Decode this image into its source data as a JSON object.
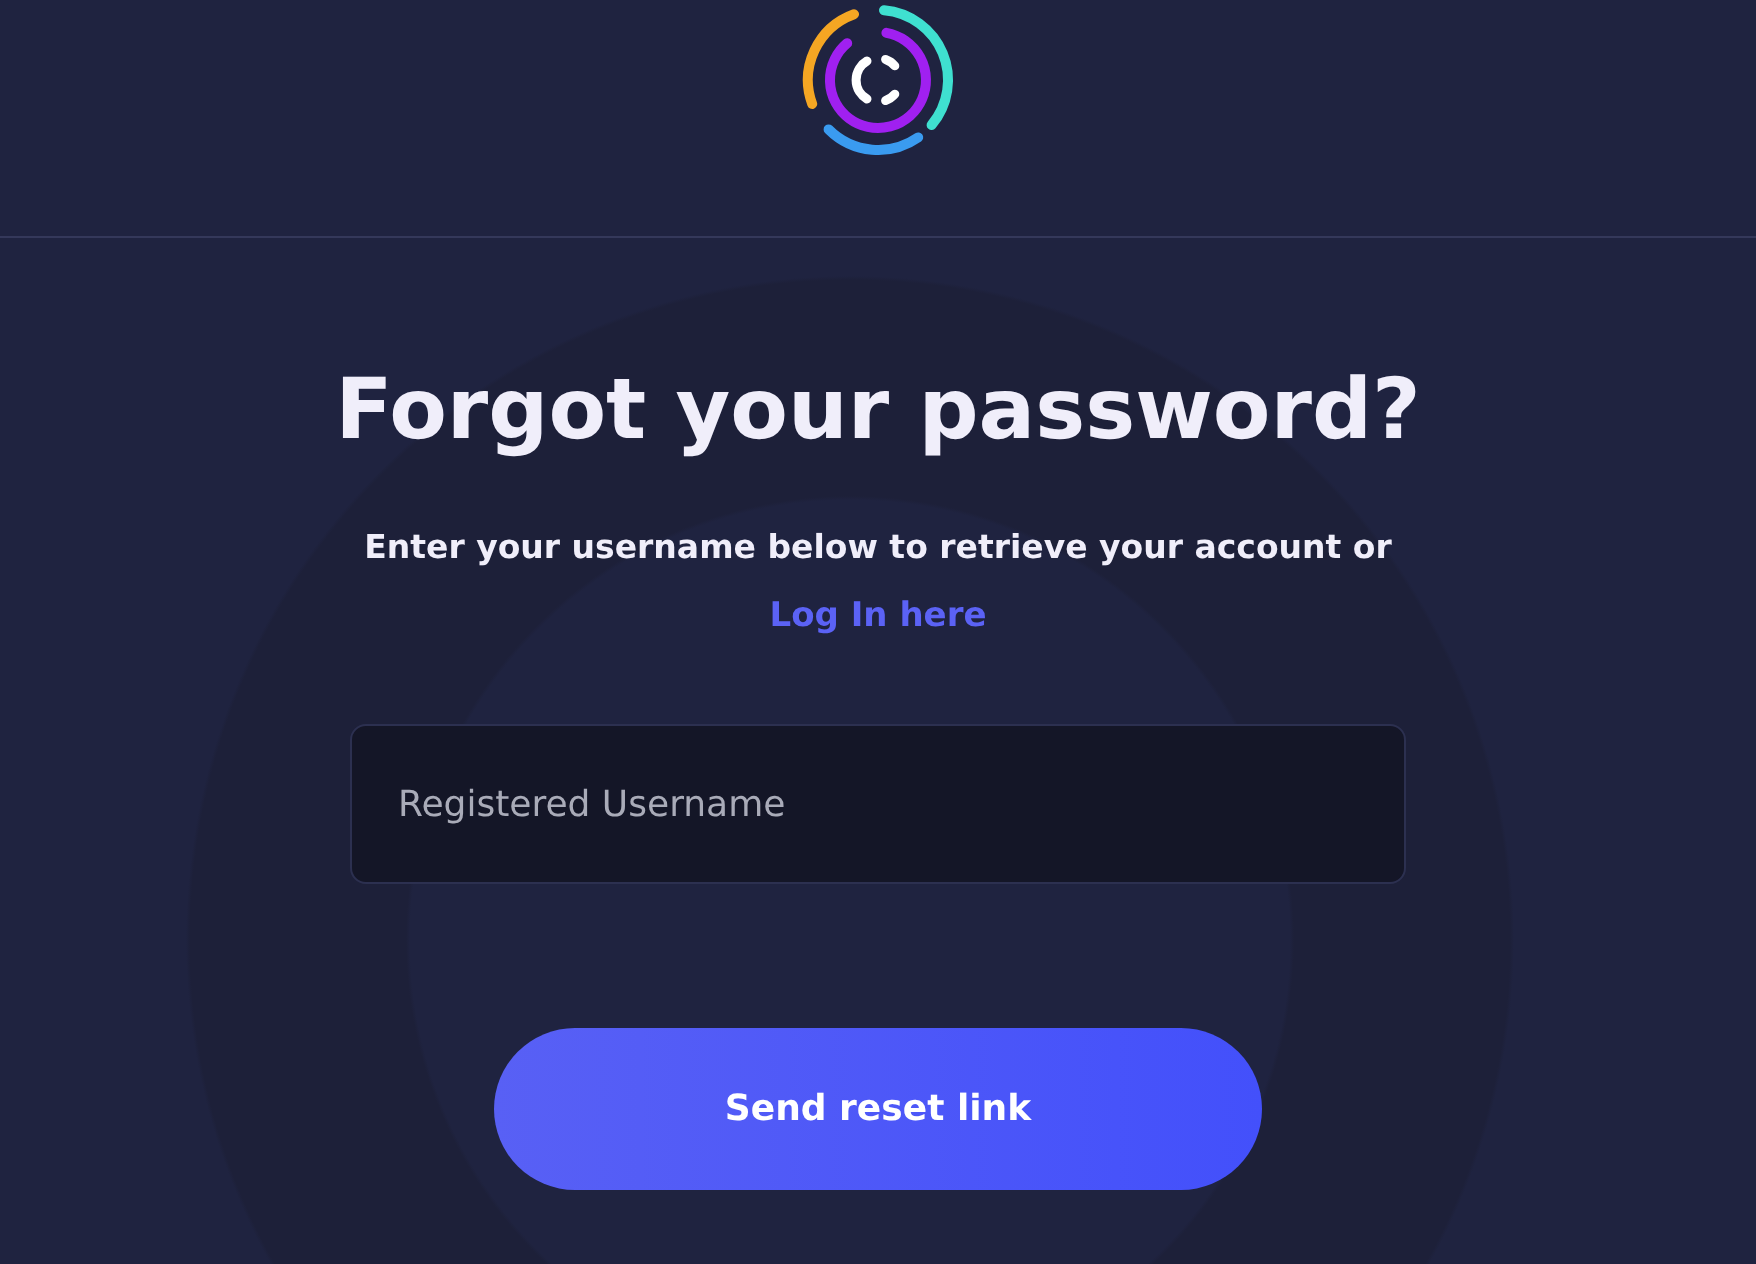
{
  "heading": "Forgot your password?",
  "intro": "Enter your username below to retrieve your account or",
  "login_link": "Log In here",
  "username_field": {
    "placeholder": "Registered Username"
  },
  "submit_button": "Send reset link"
}
